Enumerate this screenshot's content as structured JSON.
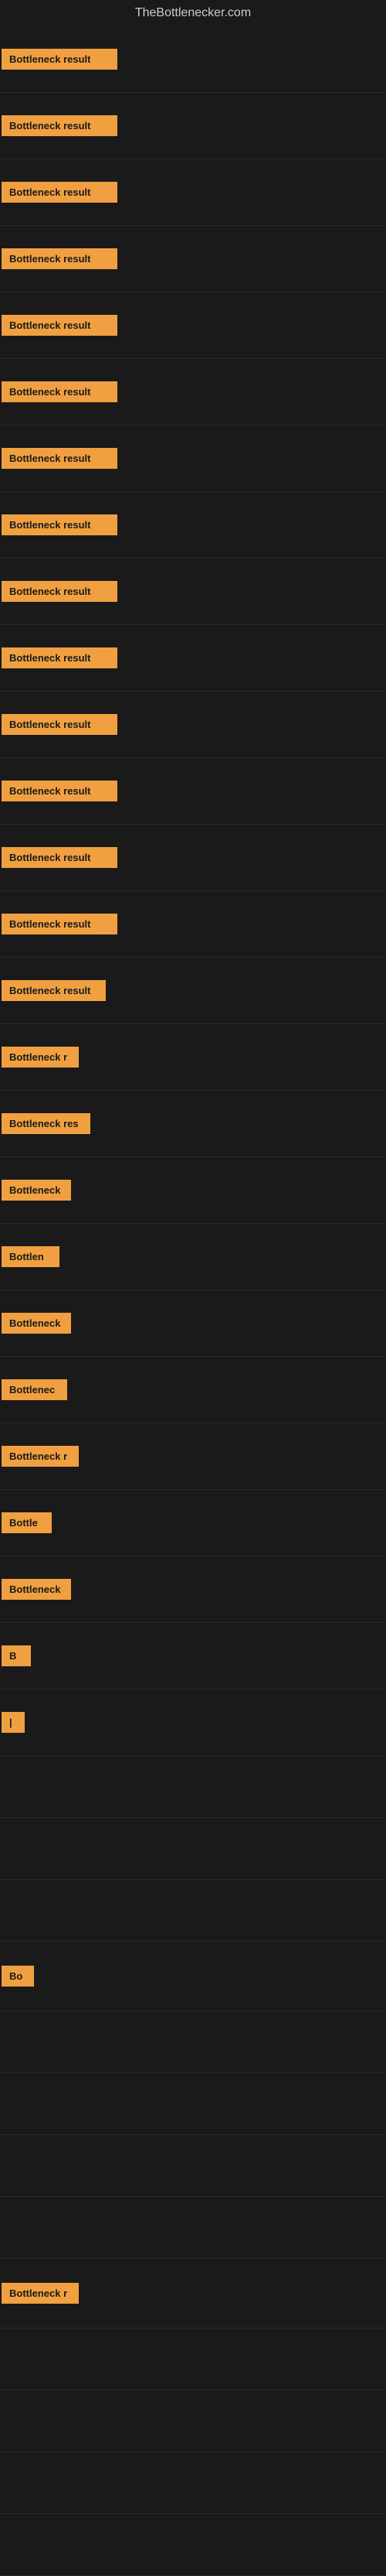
{
  "site": {
    "title": "TheBottlenecker.com"
  },
  "items": [
    {
      "id": 1,
      "label": "Bottleneck result",
      "width": 130
    },
    {
      "id": 2,
      "label": "Bottleneck result",
      "width": 130
    },
    {
      "id": 3,
      "label": "Bottleneck result",
      "width": 130
    },
    {
      "id": 4,
      "label": "Bottleneck result",
      "width": 130
    },
    {
      "id": 5,
      "label": "Bottleneck result",
      "width": 130
    },
    {
      "id": 6,
      "label": "Bottleneck result",
      "width": 130
    },
    {
      "id": 7,
      "label": "Bottleneck result",
      "width": 130
    },
    {
      "id": 8,
      "label": "Bottleneck result",
      "width": 130
    },
    {
      "id": 9,
      "label": "Bottleneck result",
      "width": 130
    },
    {
      "id": 10,
      "label": "Bottleneck result",
      "width": 130
    },
    {
      "id": 11,
      "label": "Bottleneck result",
      "width": 130
    },
    {
      "id": 12,
      "label": "Bottleneck result",
      "width": 130
    },
    {
      "id": 13,
      "label": "Bottleneck result",
      "width": 130
    },
    {
      "id": 14,
      "label": "Bottleneck result",
      "width": 130
    },
    {
      "id": 15,
      "label": "Bottleneck result",
      "width": 115
    },
    {
      "id": 16,
      "label": "Bottleneck r",
      "width": 80
    },
    {
      "id": 17,
      "label": "Bottleneck res",
      "width": 95
    },
    {
      "id": 18,
      "label": "Bottleneck",
      "width": 70
    },
    {
      "id": 19,
      "label": "Bottlen",
      "width": 55
    },
    {
      "id": 20,
      "label": "Bottleneck",
      "width": 70
    },
    {
      "id": 21,
      "label": "Bottlenec",
      "width": 65
    },
    {
      "id": 22,
      "label": "Bottleneck r",
      "width": 80
    },
    {
      "id": 23,
      "label": "Bottle",
      "width": 45
    },
    {
      "id": 24,
      "label": "Bottleneck",
      "width": 70
    },
    {
      "id": 25,
      "label": "B",
      "width": 18
    },
    {
      "id": 26,
      "label": "|",
      "width": 10
    },
    {
      "id": 27,
      "label": "",
      "width": 0
    },
    {
      "id": 28,
      "label": "",
      "width": 0
    },
    {
      "id": 29,
      "label": "",
      "width": 0
    },
    {
      "id": 30,
      "label": "Bo",
      "width": 22
    },
    {
      "id": 31,
      "label": "",
      "width": 0
    },
    {
      "id": 32,
      "label": "",
      "width": 0
    },
    {
      "id": 33,
      "label": "",
      "width": 0
    },
    {
      "id": 34,
      "label": "",
      "width": 0
    },
    {
      "id": 35,
      "label": "Bottleneck r",
      "width": 80
    },
    {
      "id": 36,
      "label": "",
      "width": 0
    },
    {
      "id": 37,
      "label": "",
      "width": 0
    },
    {
      "id": 38,
      "label": "",
      "width": 0
    },
    {
      "id": 39,
      "label": "",
      "width": 0
    }
  ],
  "colors": {
    "badge_bg": "#f0a040",
    "badge_text": "#1a1a1a",
    "background": "#1a1a1a",
    "title": "#cccccc"
  }
}
